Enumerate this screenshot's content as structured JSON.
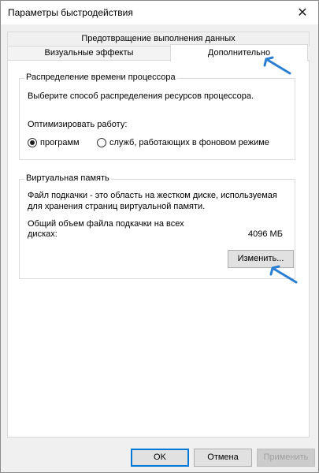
{
  "window": {
    "title": "Параметры быстродействия",
    "close_icon": "close-icon"
  },
  "tabs": {
    "dep": "Предотвращение выполнения данных",
    "visual": "Визуальные эффекты",
    "advanced": "Дополнительно"
  },
  "cpu_group": {
    "legend": "Распределение времени процессора",
    "description": "Выберите способ распределения ресурсов процессора.",
    "optimize_label": "Оптимизировать работу:",
    "options": [
      {
        "label": "программ",
        "checked": true
      },
      {
        "label": "служб, работающих в фоновом режиме",
        "checked": false
      }
    ]
  },
  "vm_group": {
    "legend": "Виртуальная память",
    "description_line1": "Файл подкачки - это область на жестком диске, используемая",
    "description_line2": "для хранения страниц виртуальной памяти.",
    "total_label_line1": "Общий объем файла подкачки на всех",
    "total_label_line2": "дисках:",
    "total_value": "4096 МБ",
    "change_button": "Изменить..."
  },
  "footer": {
    "ok": "OK",
    "cancel": "Отмена",
    "apply": "Применить"
  },
  "colors": {
    "accent": "#0078d7",
    "arrow": "#2a7fd4"
  }
}
